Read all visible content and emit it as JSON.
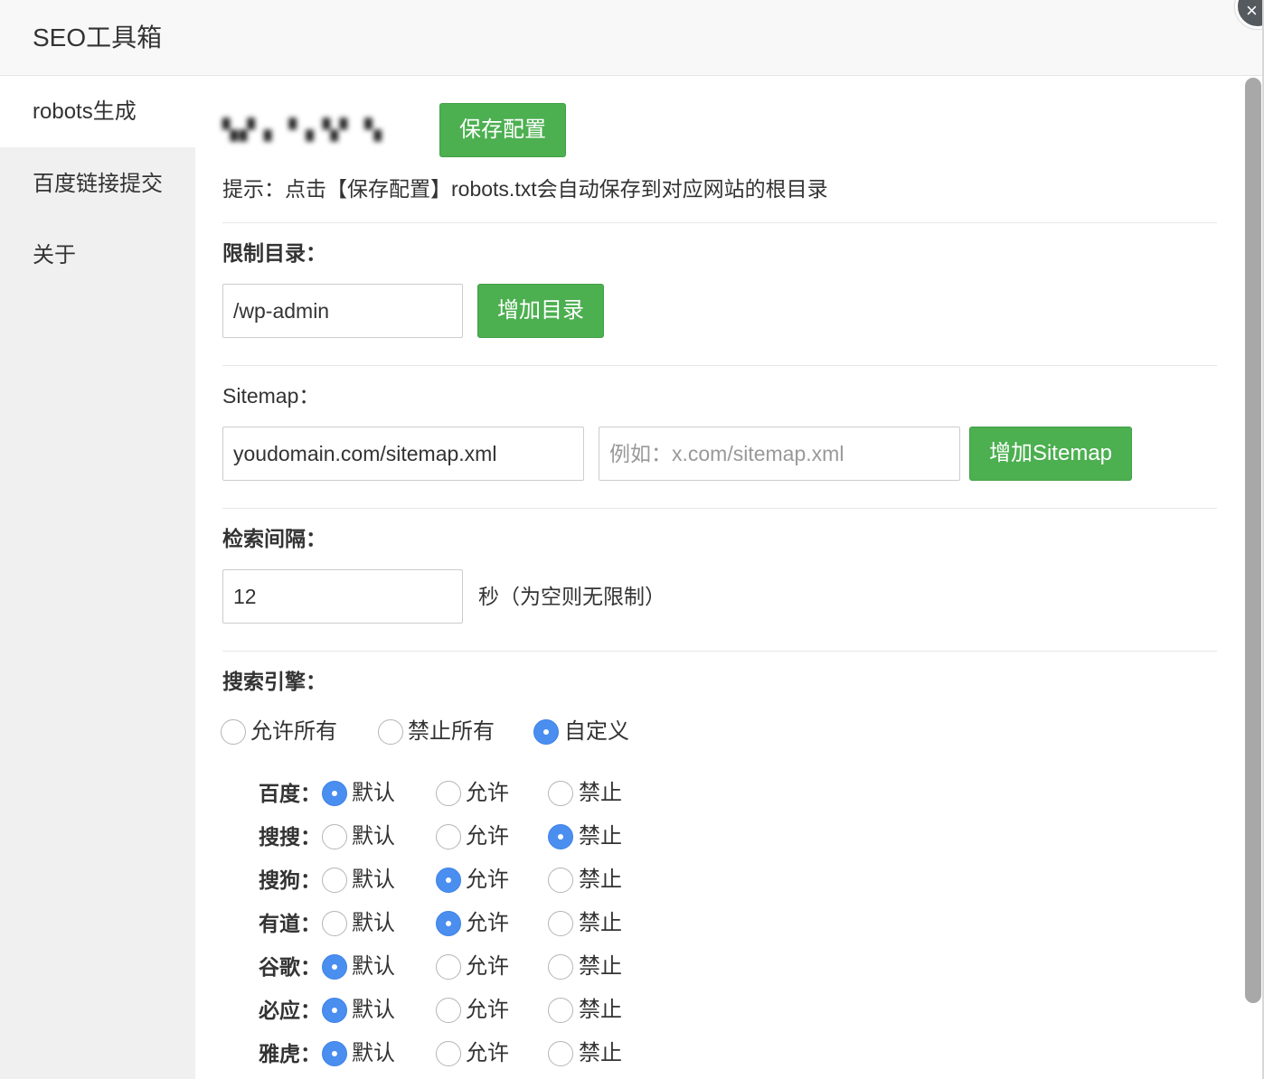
{
  "window": {
    "title": "SEO工具箱",
    "close_glyph": "×"
  },
  "sidebar": {
    "items": [
      {
        "label": "robots生成",
        "active": true
      },
      {
        "label": "百度链接提交",
        "active": false
      },
      {
        "label": "关于",
        "active": false
      }
    ]
  },
  "main": {
    "site_name": "▚▞ ▖▝▗ ▚▘▝▖",
    "save_button": "保存配置",
    "hint": "提示：点击【保存配置】robots.txt会自动保存到对应网站的根目录",
    "restrict": {
      "label": "限制目录：",
      "value": "/wp-admin",
      "add_button": "增加目录"
    },
    "sitemap": {
      "label": "Sitemap：",
      "value": "youdomain.com/sitemap.xml",
      "placeholder": "例如：x.com/sitemap.xml",
      "add_button": "增加Sitemap"
    },
    "crawl_delay": {
      "label": "检索间隔：",
      "value": "12",
      "unit": "秒（为空则无限制）"
    },
    "engines": {
      "label": "搜索引擎：",
      "modes": [
        {
          "label": "允许所有",
          "checked": false
        },
        {
          "label": "禁止所有",
          "checked": false
        },
        {
          "label": "自定义",
          "checked": true
        }
      ],
      "option_labels": [
        "默认",
        "允许",
        "禁止"
      ],
      "rows": [
        {
          "name": "百度：",
          "selected": 0
        },
        {
          "name": "搜搜：",
          "selected": 2
        },
        {
          "name": "搜狗：",
          "selected": 1
        },
        {
          "name": "有道：",
          "selected": 1
        },
        {
          "name": "谷歌：",
          "selected": 0
        },
        {
          "name": "必应：",
          "selected": 0
        },
        {
          "name": "雅虎：",
          "selected": 0
        }
      ]
    }
  },
  "colors": {
    "accent_green": "#4caf50",
    "radio_blue": "#4a8ef0"
  }
}
